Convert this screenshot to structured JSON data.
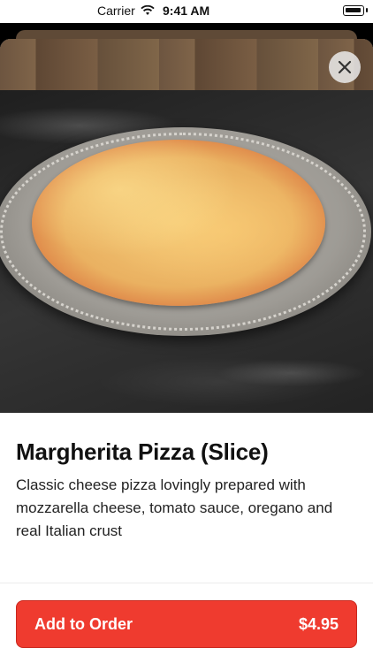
{
  "status_bar": {
    "carrier": "Carrier",
    "time": "9:41 AM"
  },
  "item": {
    "title": "Margherita Pizza (Slice)",
    "description": "Classic cheese pizza lovingly prepared with mozzarella cheese, tomato sauce, oregano and real Italian crust",
    "image_alt": "Margherita pizza on a metal tray"
  },
  "actions": {
    "add_label": "Add to Order",
    "price": "$4.95"
  },
  "icons": {
    "close": "close-icon",
    "favorite": "heart-icon",
    "wifi": "wifi-icon",
    "battery": "battery-icon"
  },
  "colors": {
    "accent": "#ef3b2f"
  }
}
